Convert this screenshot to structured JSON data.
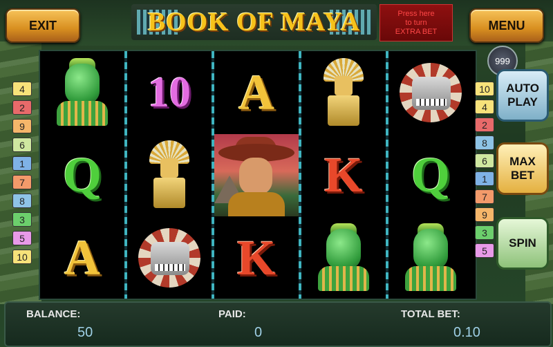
{
  "header": {
    "exit_label": "EXIT",
    "menu_label": "MENU",
    "logo_text": "BOOK OF MAYA",
    "extra_bet_lines": [
      "Press here",
      "to turn",
      "EXTRA BET"
    ]
  },
  "coin_badge": "999",
  "reels": [
    [
      "mask",
      "Q",
      "A"
    ],
    [
      "10",
      "statue",
      "snake"
    ],
    [
      "A",
      "explorer",
      "K"
    ],
    [
      "statue",
      "K",
      "mask"
    ],
    [
      "snake",
      "Q",
      "mask"
    ]
  ],
  "paylines_left": [
    {
      "n": "4",
      "color": "#f7e27a"
    },
    {
      "n": "2",
      "color": "#e86a6a"
    },
    {
      "n": "9",
      "color": "#f5b66a"
    },
    {
      "n": "6",
      "color": "#cfe7a0"
    },
    {
      "n": "1",
      "color": "#7fb2e6"
    },
    {
      "n": "7",
      "color": "#f39a6a"
    },
    {
      "n": "8",
      "color": "#8ec3e6"
    },
    {
      "n": "3",
      "color": "#6ccf6c"
    },
    {
      "n": "5",
      "color": "#e89ae8"
    },
    {
      "n": "10",
      "color": "#f7e27a"
    }
  ],
  "paylines_right": [
    {
      "n": "10",
      "color": "#f7e27a"
    },
    {
      "n": "4",
      "color": "#f7e27a"
    },
    {
      "n": "2",
      "color": "#e86a6a"
    },
    {
      "n": "8",
      "color": "#8ec3e6"
    },
    {
      "n": "6",
      "color": "#cfe7a0"
    },
    {
      "n": "1",
      "color": "#7fb2e6"
    },
    {
      "n": "7",
      "color": "#f39a6a"
    },
    {
      "n": "9",
      "color": "#f5b66a"
    },
    {
      "n": "3",
      "color": "#6ccf6c"
    },
    {
      "n": "5",
      "color": "#e89ae8"
    }
  ],
  "buttons": {
    "auto_play": [
      "AUTO",
      "PLAY"
    ],
    "max_bet": [
      "MAX",
      "BET"
    ],
    "spin": "SPIN"
  },
  "bottom": {
    "balance_label": "BALANCE:",
    "balance_value": "50",
    "paid_label": "PAID:",
    "paid_value": "0",
    "total_bet_label": "TOTAL BET:",
    "total_bet_value": "0.10"
  }
}
